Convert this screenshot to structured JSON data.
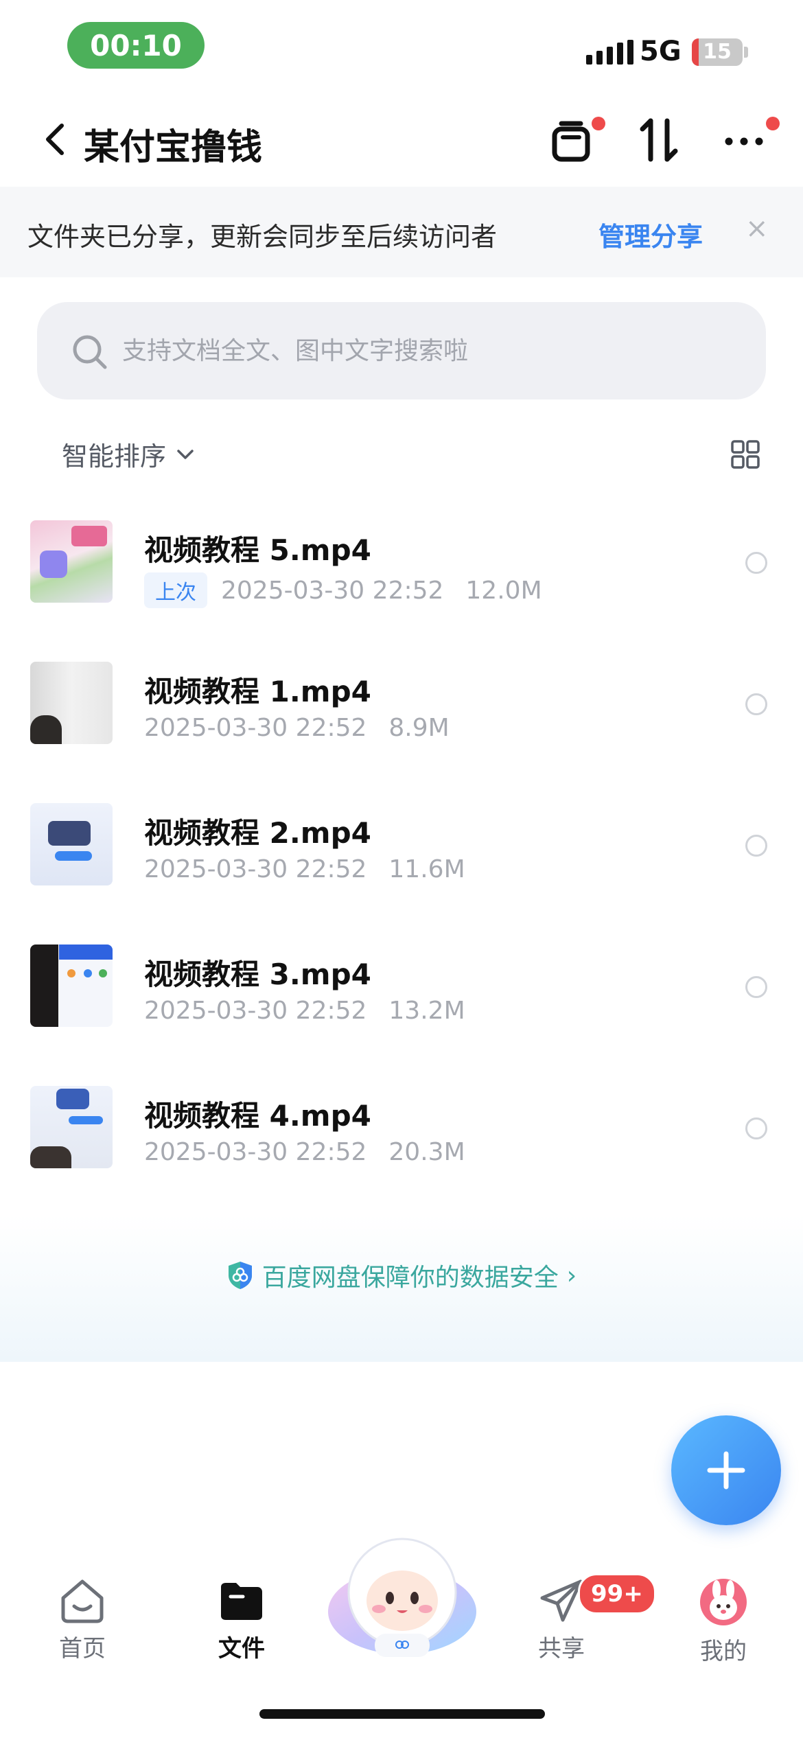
{
  "status_bar": {
    "time": "00:10",
    "network": "5G",
    "battery_level": "15"
  },
  "header": {
    "title": "某付宝撸钱"
  },
  "banner": {
    "text": "文件夹已分享，更新会同步至后续访问者",
    "link": "管理分享",
    "close": "×"
  },
  "search": {
    "placeholder": "支持文档全文、图中文字搜索啦"
  },
  "sort": {
    "label": "智能排序"
  },
  "files": [
    {
      "name": "视频教程 5.mp4",
      "tag": "上次",
      "date": "2025-03-30 22:52",
      "size": "12.0M"
    },
    {
      "name": "视频教程 1.mp4",
      "date": "2025-03-30 22:52",
      "size": "8.9M"
    },
    {
      "name": "视频教程 2.mp4",
      "date": "2025-03-30 22:52",
      "size": "11.6M"
    },
    {
      "name": "视频教程 3.mp4",
      "date": "2025-03-30 22:52",
      "size": "13.2M"
    },
    {
      "name": "视频教程 4.mp4",
      "date": "2025-03-30 22:52",
      "size": "20.3M"
    }
  ],
  "security": {
    "text": "百度网盘保障你的数据安全",
    "chevron": "›"
  },
  "nav": {
    "home": "首页",
    "files": "文件",
    "share": "共享",
    "share_badge": "99+",
    "me": "我的"
  },
  "colors": {
    "accent": "#3a85f0",
    "status_green": "#4cb05a",
    "alert_red": "#ee4b4b",
    "secure_teal": "#3aa79e"
  }
}
